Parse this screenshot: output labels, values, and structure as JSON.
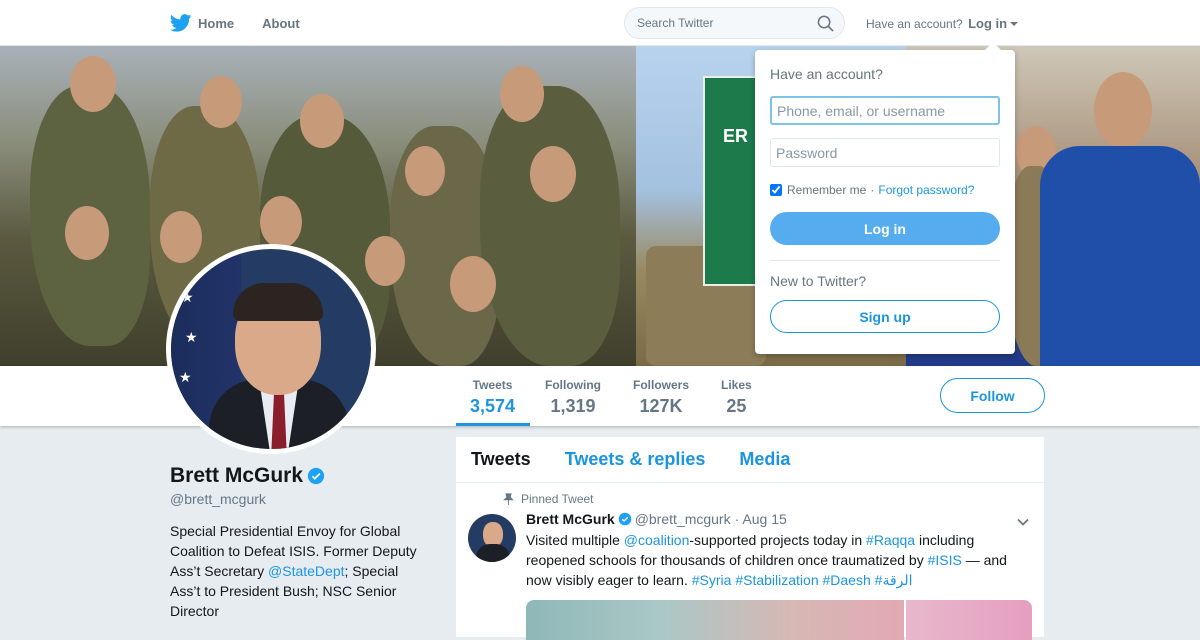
{
  "topbar": {
    "home_label": "Home",
    "about_label": "About",
    "search_placeholder": "Search Twitter",
    "account_prompt": "Have an account?",
    "login_label": "Log in"
  },
  "stats": [
    {
      "label": "Tweets",
      "value": "3,574"
    },
    {
      "label": "Following",
      "value": "1,319"
    },
    {
      "label": "Followers",
      "value": "127K"
    },
    {
      "label": "Likes",
      "value": "25"
    }
  ],
  "follow_label": "Follow",
  "profile": {
    "name": "Brett McGurk",
    "handle": "@brett_mcgurk",
    "bio_part1": "Special Presidential Envoy for Global Coalition to Defeat ISIS. Former Deputy Ass’t Secretary ",
    "bio_link": "@StateDept",
    "bio_part2": "; Special Ass’t to President Bush; NSC Senior Director"
  },
  "timeline": {
    "tabs": [
      "Tweets",
      "Tweets & replies",
      "Media"
    ],
    "pinned_label": "Pinned Tweet",
    "tweet": {
      "name": "Brett McGurk",
      "handle": "@brett_mcgurk",
      "date": "· Aug 15",
      "text": [
        "Visited multiple ",
        "@coalition",
        "-supported projects today in ",
        "#Raqqa",
        " including reopened schools for thousands of children once traumatized by ",
        "#ISIS",
        " — and now visibly eager to learn. ",
        "#Syria #Stabilization #Daesh #الرقة"
      ]
    }
  },
  "login_dropdown": {
    "title": "Have an account?",
    "username_placeholder": "Phone, email, or username",
    "password_placeholder": "Password",
    "remember_label": "Remember me",
    "separator": "·",
    "forgot_label": "Forgot password?",
    "login_button": "Log in",
    "new_prompt": "New to Twitter?",
    "signup_button": "Sign up"
  },
  "colors": {
    "accent": "#1b95e0",
    "login_button": "#55acee",
    "verified": "#1da1f2"
  },
  "icons": [
    "twitter-bird-icon",
    "search-icon",
    "verified-badge-icon",
    "pin-icon",
    "chevron-down-icon"
  ]
}
